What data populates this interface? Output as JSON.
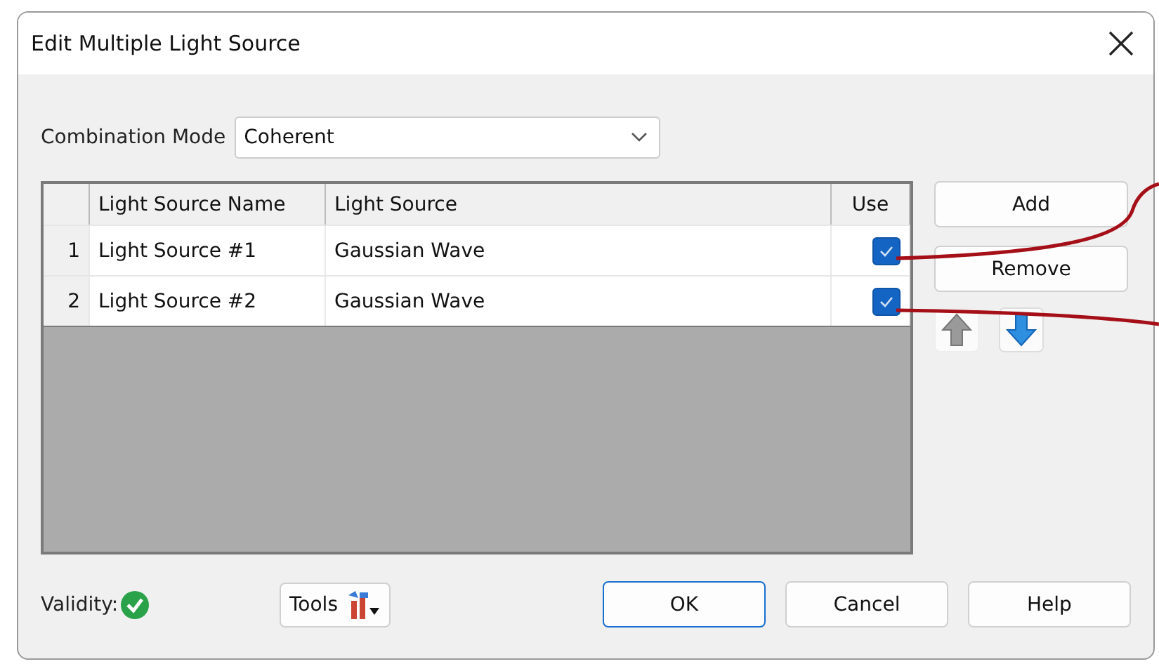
{
  "window": {
    "title": "Edit Multiple Light Source"
  },
  "combination_mode": {
    "label": "Combination Mode",
    "value": "Coherent"
  },
  "table": {
    "columns": [
      "Light Source Name",
      "Light Source",
      "Use"
    ],
    "rows": [
      {
        "index": "1",
        "name": "Light Source #1",
        "source": "Gaussian Wave",
        "use": true
      },
      {
        "index": "2",
        "name": "Light Source #2",
        "source": "Gaussian Wave",
        "use": true
      }
    ]
  },
  "side_buttons": [
    "Add",
    "Remove"
  ],
  "move_buttons": [
    {
      "kind": "up",
      "disabled": true
    },
    {
      "kind": "down",
      "disabled": false
    }
  ],
  "validity": {
    "label": "Validity:",
    "valid": true
  },
  "tools_button": "Tools",
  "footer_buttons": [
    {
      "label": "OK",
      "default": true
    },
    {
      "label": "Cancel",
      "default": false
    },
    {
      "label": "Help",
      "default": false
    }
  ]
}
